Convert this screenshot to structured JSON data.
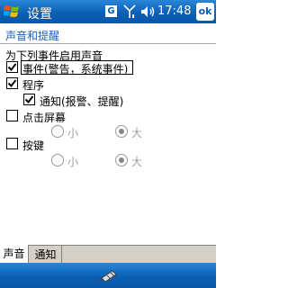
{
  "window": {
    "title": "设置",
    "time": "17:48",
    "ok_label": "ok",
    "status_letter": "G"
  },
  "page": {
    "title": "声音和提醒",
    "caption": "为下列事件启用声音"
  },
  "options": {
    "events": {
      "label": "事件(警告，系统事件)",
      "checked": true
    },
    "programs": {
      "label": "程序",
      "checked": true
    },
    "notifications": {
      "label": "通知(报警、提醒)",
      "checked": true
    },
    "screen_taps": {
      "label": "点击屏幕",
      "checked": false,
      "soft": "小",
      "loud": "大",
      "selected": "大"
    },
    "buttons": {
      "label": "按键",
      "checked": false,
      "soft": "小",
      "loud": "大",
      "selected": "大"
    }
  },
  "tabs": [
    {
      "label": "声音",
      "active": true
    },
    {
      "label": "通知",
      "active": false
    }
  ],
  "icons": [
    "windows-start-icon",
    "signal-icon",
    "volume-icon",
    "keyboard-icon",
    "checkmark-icon"
  ],
  "colors": {
    "titlebar": "#0a5fb4",
    "heading": "#1c5fb8"
  }
}
